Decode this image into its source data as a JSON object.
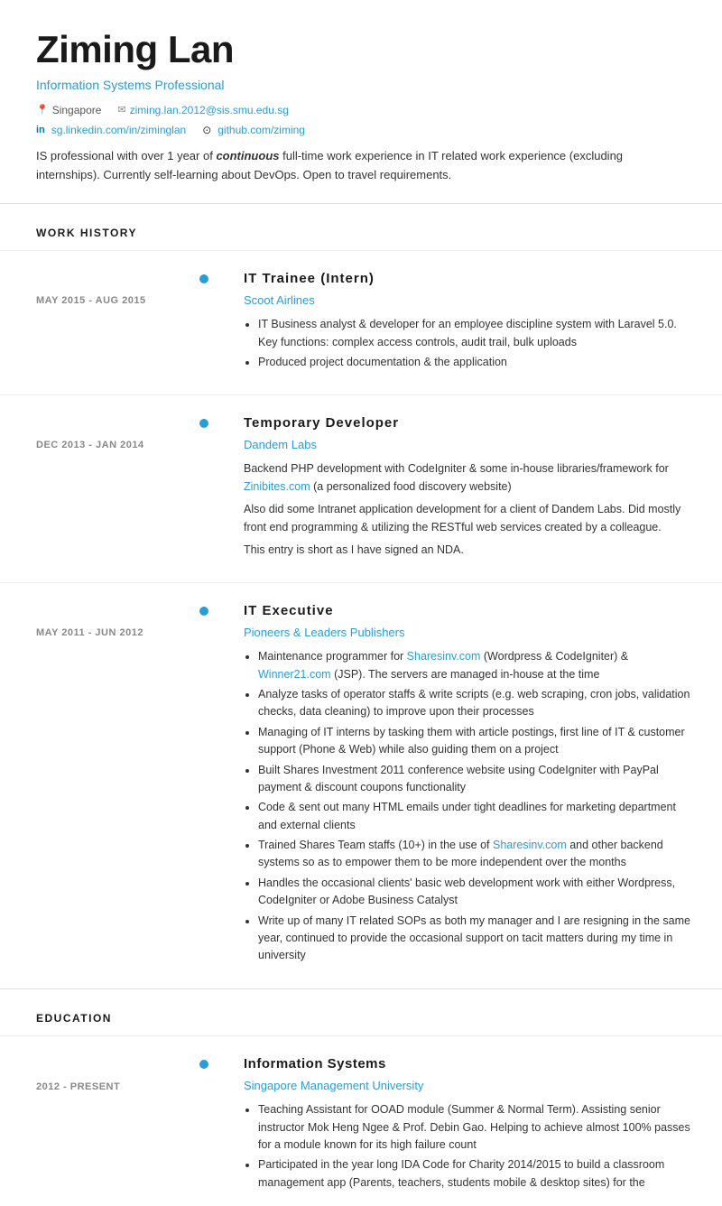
{
  "header": {
    "name": "Ziming Lan",
    "title": "Information Systems Professional",
    "location": "Singapore",
    "email": "ziming.lan.2012@sis.smu.edu.sg",
    "linkedin_url": "sg.linkedin.com/in/ziminglan",
    "github_url": "github.com/ziming",
    "summary": "IS professional with over 1 year of continuous full-time work experience in IT related work experience (excluding internships). Currently self-learning about DevOps. Open to travel requirements."
  },
  "sections": {
    "work": {
      "label": "WORK HISTORY",
      "jobs": [
        {
          "date": "MAY 2015 - AUG 2015",
          "title": "IT Trainee (Intern)",
          "company": "Scoot Airlines",
          "bullets": [
            "IT Business analyst & developer for an employee discipline system with Laravel 5.0. Key functions: complex access controls, audit trail, bulk uploads",
            "Produced project documentation & the application"
          ],
          "paragraphs": []
        },
        {
          "date": "DEC 2013 - JAN 2014",
          "title": "Temporary Developer",
          "company": "Dandem Labs",
          "bullets": [],
          "paragraphs": [
            "Backend PHP development with CodeIgniter & some in-house libraries/framework for Zinibites.com (a personalized food discovery website)",
            "Also did some Intranet application development for a client of Dandem Labs. Did mostly front end programming & utilizing the RESTful web services created by a colleague.",
            "This entry is short as I have signed an NDA."
          ],
          "link_text": "Zinibites.com",
          "link_url": "#"
        },
        {
          "date": "MAY 2011 - JUN 2012",
          "title": "IT Executive",
          "company": "Pioneers & Leaders Publishers",
          "bullets": [
            "Maintenance programmer for Sharesinv.com (Wordpress & CodeIgniter) & Winner21.com (JSP). The servers are managed in-house at the time",
            "Analyze tasks of operator staffs & write scripts (e.g. web scraping, cron jobs, validation checks, data cleaning) to improve upon their processes",
            "Managing of IT interns by tasking them with article postings, first line of IT & customer support (Phone & Web) while also guiding them on a project",
            "Built Shares Investment 2011 conference website using CodeIgniter with PayPal payment & discount coupons functionality",
            "Code & sent out many HTML emails under tight deadlines for marketing department and external clients",
            "Trained Shares Team staffs (10+) in the use of Sharesinv.com and other backend systems so as to empower them to be more independent over the months",
            "Handles the occasional clients' basic web development work with either Wordpress, CodeIgniter or Adobe Business Catalyst",
            "Write up of many IT related SOPs as both my manager and I are resigning in the same year, continued to provide the occasional support on tacit matters during my time in university"
          ]
        }
      ]
    },
    "education": {
      "label": "EDUCATION",
      "entries": [
        {
          "date": "2012 - PRESENT",
          "degree": "Information Systems",
          "school": "Singapore Management University",
          "bullets": [
            "Teaching Assistant for OOAD module (Summer & Normal Term). Assisting senior instructor Mok Heng Ngee & Prof. Debin Gao. Helping to achieve almost 100% passes for a module known for its high failure count",
            "Participated in the year long IDA Code for Charity 2014/2015 to build a classroom management app (Parents, teachers, students mobile & desktop sites) for the"
          ]
        }
      ]
    }
  }
}
